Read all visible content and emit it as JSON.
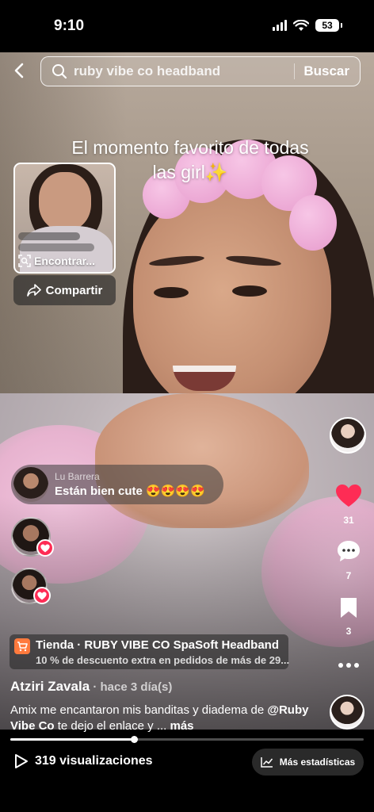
{
  "status": {
    "time": "9:10",
    "battery": "53"
  },
  "search": {
    "query": "ruby vibe co headband",
    "button": "Buscar"
  },
  "overlay_caption": {
    "line1": "El momento favorito de todas",
    "line2": "las girl✨"
  },
  "pip": {
    "find_label": "Encontrar...",
    "share_label": "Compartir"
  },
  "rail": {
    "likes": "31",
    "comments": "7",
    "saves": "3"
  },
  "comment": {
    "author": "Lu Barrera",
    "text": "Están bien cute 😍😍😍😍"
  },
  "shop": {
    "title": "Tienda · RUBY VIBE CO SpaSoft Headband",
    "subtitle": "10 % de descuento extra en pedidos de más de 29..."
  },
  "post": {
    "author": "Atziri Zavala",
    "time": " · hace 3 día(s)",
    "desc_start": "Amix me encantaron mis banditas y diadema de ",
    "mention": "@Ruby Vibe Co",
    "desc_end": " te dejo el enlace y ... ",
    "more": "más",
    "progress": 0.35
  },
  "footer": {
    "views": "319 visualizaciones",
    "stats_button": "Más estadísticas"
  },
  "colors": {
    "like": "#fe2c55",
    "shop": "#ff7a3d"
  }
}
